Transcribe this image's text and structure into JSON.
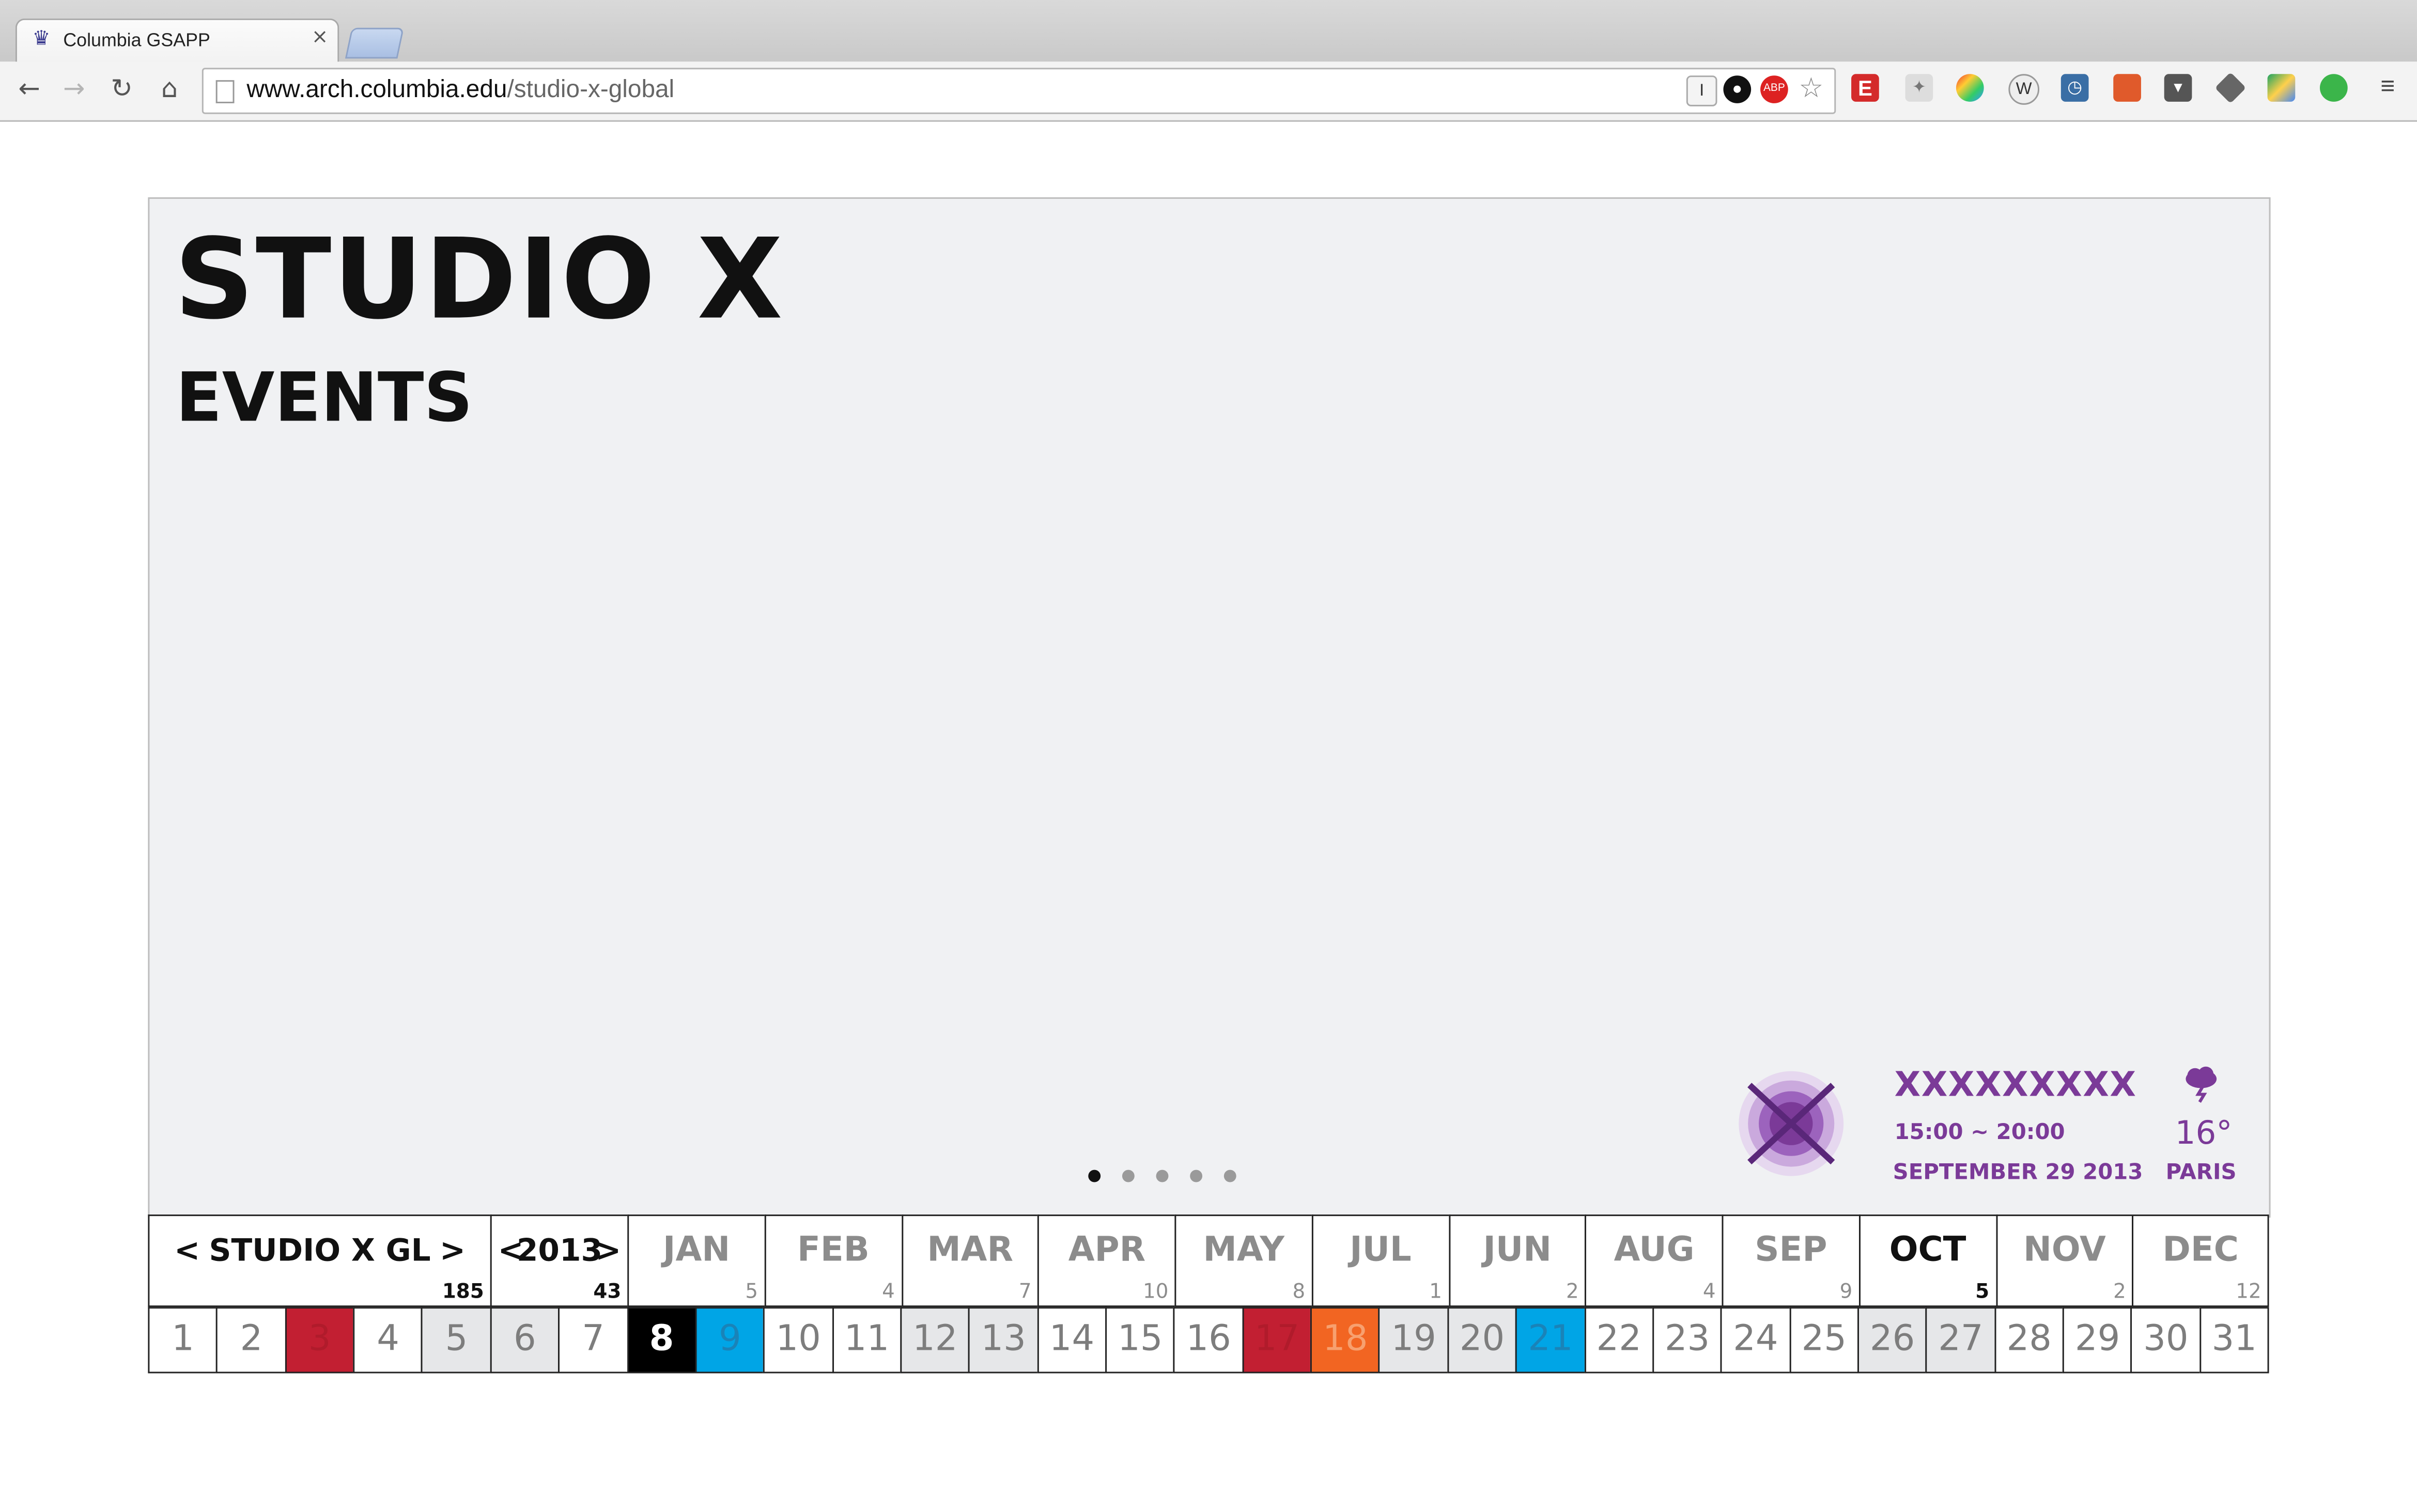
{
  "browser": {
    "tab_title": "Columbia GSAPP",
    "url_host": "www.arch.columbia.edu",
    "url_path": "/studio-x-global"
  },
  "page": {
    "title": "STUDIO X",
    "subtitle": "EVENTS"
  },
  "slider": {
    "count": 5,
    "active": 0
  },
  "event": {
    "name": "XXXXXXXXX",
    "time": "15:00 ~ 20:00",
    "date": "SEPTEMBER 29 2013",
    "accent_color": "#7b3a98"
  },
  "weather": {
    "icon": "storm-cloud-icon",
    "temp": "16°",
    "city": "PARIS"
  },
  "calendar": {
    "location": {
      "prev": "<",
      "label": "STUDIO X GL",
      "next": ">",
      "count": "185"
    },
    "year": {
      "prev": "<",
      "label": "2013",
      "next": ">",
      "count": "43"
    },
    "months": [
      {
        "label": "JAN",
        "count": "5"
      },
      {
        "label": "FEB",
        "count": "4"
      },
      {
        "label": "MAR",
        "count": "7"
      },
      {
        "label": "APR",
        "count": "10"
      },
      {
        "label": "MAY",
        "count": "8"
      },
      {
        "label": "JUL",
        "count": "1"
      },
      {
        "label": "JUN",
        "count": "2"
      },
      {
        "label": "AUG",
        "count": "4"
      },
      {
        "label": "SEP",
        "count": "9"
      },
      {
        "label": "OCT",
        "count": "5",
        "active": true
      },
      {
        "label": "NOV",
        "count": "2"
      },
      {
        "label": "DEC",
        "count": "12"
      }
    ],
    "days": [
      {
        "n": "1",
        "style": ""
      },
      {
        "n": "2",
        "style": ""
      },
      {
        "n": "3",
        "style": "red"
      },
      {
        "n": "4",
        "style": ""
      },
      {
        "n": "5",
        "style": "gray"
      },
      {
        "n": "6",
        "style": "gray"
      },
      {
        "n": "7",
        "style": ""
      },
      {
        "n": "8",
        "style": "black"
      },
      {
        "n": "9",
        "style": "blue"
      },
      {
        "n": "10",
        "style": ""
      },
      {
        "n": "11",
        "style": ""
      },
      {
        "n": "12",
        "style": "gray"
      },
      {
        "n": "13",
        "style": "gray"
      },
      {
        "n": "14",
        "style": ""
      },
      {
        "n": "15",
        "style": ""
      },
      {
        "n": "16",
        "style": ""
      },
      {
        "n": "17",
        "style": "red"
      },
      {
        "n": "18",
        "style": "orange"
      },
      {
        "n": "19",
        "style": "gray"
      },
      {
        "n": "20",
        "style": "gray"
      },
      {
        "n": "21",
        "style": "blue"
      },
      {
        "n": "22",
        "style": ""
      },
      {
        "n": "23",
        "style": ""
      },
      {
        "n": "24",
        "style": ""
      },
      {
        "n": "25",
        "style": ""
      },
      {
        "n": "26",
        "style": "gray"
      },
      {
        "n": "27",
        "style": "gray"
      },
      {
        "n": "28",
        "style": ""
      },
      {
        "n": "29",
        "style": ""
      },
      {
        "n": "30",
        "style": ""
      },
      {
        "n": "31",
        "style": ""
      }
    ]
  }
}
